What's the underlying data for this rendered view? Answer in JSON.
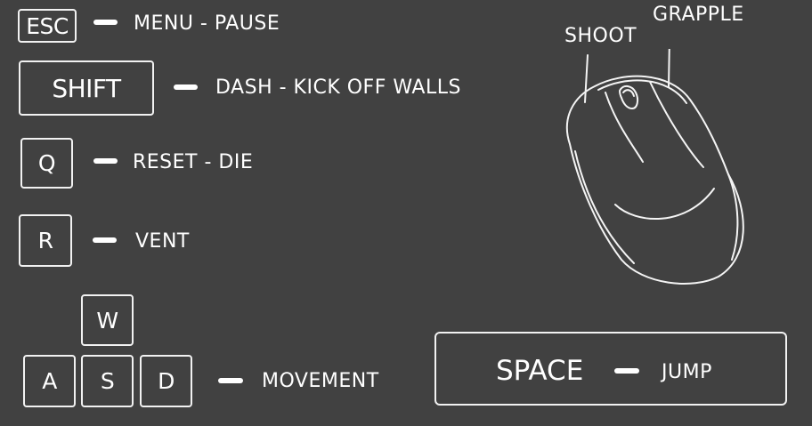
{
  "bindings": [
    {
      "key": "ESC",
      "action": "MENU - PAUSE"
    },
    {
      "key": "SHIFT",
      "action": "DASH - KICK OFF WALLS"
    },
    {
      "key": "Q",
      "action": "RESET - DIE"
    },
    {
      "key": "R",
      "action": "VENT"
    }
  ],
  "movement": {
    "keys": {
      "up": "W",
      "left": "A",
      "down": "S",
      "right": "D"
    },
    "action": "MOVEMENT"
  },
  "mouse": {
    "left_button": "SHOOT",
    "right_button": "GRAPPLE",
    "icon": "computer-mouse-icon"
  },
  "space": {
    "key": "SPACE",
    "action": "JUMP"
  }
}
